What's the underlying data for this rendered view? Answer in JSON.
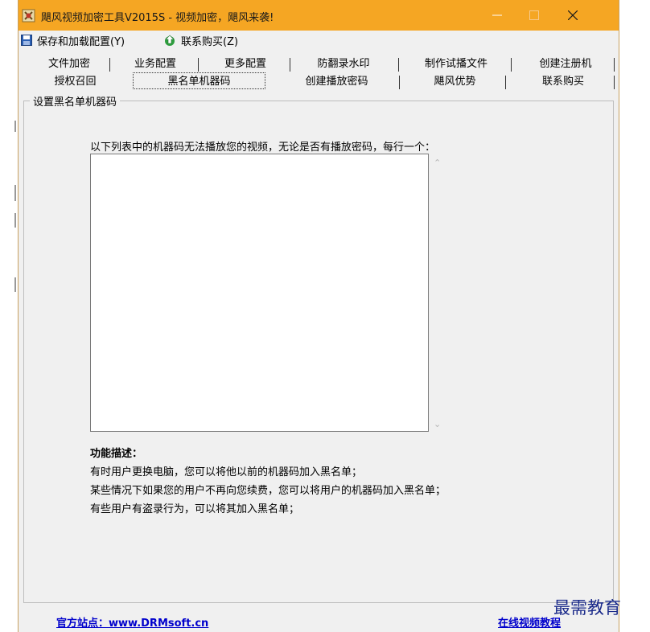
{
  "window": {
    "title": "飓风视频加密工具V2015S - 视频加密，飓风来袭!",
    "accent_color": "#f5a623"
  },
  "menu": {
    "save_label": "保存和加载配置(Y)",
    "buy_label": "联系购买(Z)"
  },
  "tabs_row1": [
    {
      "label": "文件加密"
    },
    {
      "label": "业务配置"
    },
    {
      "label": "更多配置"
    },
    {
      "label": "防翻录水印"
    },
    {
      "label": "制作试播文件"
    },
    {
      "label": "创建注册机"
    }
  ],
  "tabs_row2": [
    {
      "label": "授权召回"
    },
    {
      "label": "黑名单机器码",
      "active": true
    },
    {
      "label": "创建播放密码"
    },
    {
      "label": "飓风优势"
    },
    {
      "label": "联系购买"
    }
  ],
  "panel": {
    "group_title": "设置黑名单机器码",
    "instruction": "以下列表中的机器码无法播放您的视频，无论是否有播放密码，每行一个：",
    "textarea_value": "",
    "description_title": "功能描述：",
    "description_lines": [
      "有时用户更换电脑，您可以将他以前的机器码加入黑名单；",
      "某些情况下如果您的用户不再向您续费，您可以将用户的机器码加入黑名单；",
      "有些用户有盗录行为，可以将其加入黑名单；"
    ]
  },
  "footer": {
    "official_site": "官方站点：www.DRMsoft.cn",
    "tutorial": "在线视频教程"
  },
  "watermark": "最需教育",
  "icons": {
    "app": "app-icon",
    "save": "floppy-disk-icon",
    "buy": "green-arrow-icon"
  }
}
